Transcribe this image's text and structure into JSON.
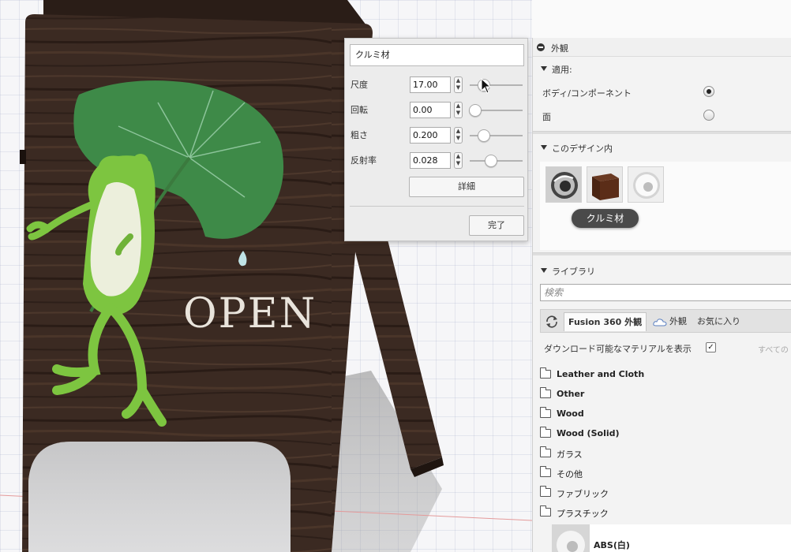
{
  "popup": {
    "material_name": "クルミ材",
    "properties": [
      {
        "label": "尺度",
        "value": "17.00",
        "slider": 0.27
      },
      {
        "label": "回転",
        "value": "0.00",
        "slider": 0.1
      },
      {
        "label": "粗さ",
        "value": "0.200",
        "slider": 0.27
      },
      {
        "label": "反射率",
        "value": "0.028",
        "slider": 0.4
      }
    ],
    "detail_button": "詳細",
    "done_button": "完了"
  },
  "scene": {
    "sign_text": "OPEN",
    "wood_color": "#3b2a22",
    "leaf_color": "#3e8a48",
    "frog_color": "#7dc540"
  },
  "panel": {
    "header": "外観",
    "apply": {
      "title": "適用:",
      "options": [
        {
          "label": "ボディ/コンポーネント",
          "selected": true
        },
        {
          "label": "面",
          "selected": false
        }
      ]
    },
    "in_design": {
      "title": "このデザイン内",
      "thumbnails": [
        "chrome-ring",
        "walnut-cube",
        "white-ring"
      ],
      "tooltip": "クルミ材"
    },
    "library": {
      "title": "ライブラリ",
      "search_placeholder": "検索",
      "tabs": [
        "Fusion 360 外観",
        "外観",
        "お気に入り"
      ],
      "download_label": "ダウンロード可能なマテリアルを表示",
      "download_checked": true,
      "all_label": "すべての",
      "folders": [
        {
          "label": "Leather and Cloth",
          "bold": true
        },
        {
          "label": "Other",
          "bold": true
        },
        {
          "label": "Wood",
          "bold": true
        },
        {
          "label": "Wood (Solid)",
          "bold": true
        },
        {
          "label": "ガラス",
          "bold": false
        },
        {
          "label": "その他",
          "bold": false
        },
        {
          "label": "ファブリック",
          "bold": false
        },
        {
          "label": "プラスチック",
          "bold": false
        }
      ],
      "first_item": "ABS(白)"
    }
  }
}
